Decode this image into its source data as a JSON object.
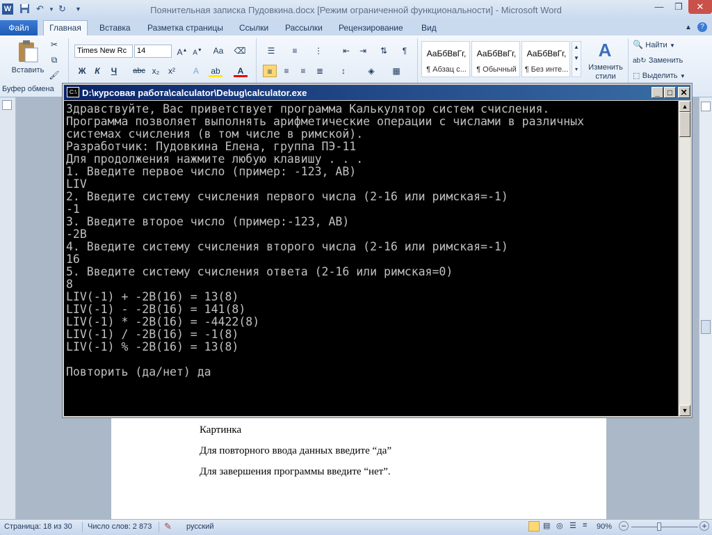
{
  "window": {
    "title": "Поянительная записка Пудовкина.docx [Режим ограниченной функциональности]  -  Microsoft Word"
  },
  "quick_access": {
    "word_icon": "W",
    "save_icon": "save-icon",
    "undo_icon": "undo-icon",
    "redo_icon": "redo-icon"
  },
  "tabs": [
    {
      "label": "Файл"
    },
    {
      "label": "Главная"
    },
    {
      "label": "Вставка"
    },
    {
      "label": "Разметка страницы"
    },
    {
      "label": "Ссылки"
    },
    {
      "label": "Рассылки"
    },
    {
      "label": "Рецензирование"
    },
    {
      "label": "Вид"
    }
  ],
  "ribbon": {
    "paste_label": "Вставить",
    "clipboard_group": "Буфер обмена",
    "font_name": "Times New Rc",
    "font_size": "14",
    "bold": "Ж",
    "italic": "К",
    "underline": "Ч",
    "strike": "abc",
    "subscript": "x₂",
    "superscript": "x²",
    "styles": [
      {
        "sample": "АаБбВвГг,",
        "name": "¶ Абзац с..."
      },
      {
        "sample": "АаБбВвГг,",
        "name": "¶ Обычный"
      },
      {
        "sample": "АаБбВвГг,",
        "name": "¶ Без инте..."
      }
    ],
    "change_styles": "Изменить стили",
    "find": "Найти",
    "replace": "Заменить",
    "select": "Выделить"
  },
  "console": {
    "title": "D:\\курсовая работа\\calculator\\Debug\\calculator.exe",
    "icon_text": "C:\\",
    "lines": [
      "Здравствуйте, Вас приветствует программа Калькулятор систем счисления.",
      "Программа позволяет выполнять арифметические операции с числами в различных",
      "системах счисления (в том числе в римской).",
      "Разработчик: Пудовкина Елена, группа ПЭ-11",
      "Для продолжения нажмите любую клавишу . . .",
      "1. Введите первое число (пример: -123, AB)",
      "LIV",
      "2. Введите систему счисления первого числа (2-16 или римская=-1)",
      "-1",
      "3. Введите второе число (пример:-123, AB)",
      "-2B",
      "4. Введите систему счисления второго числа (2-16 или римская=-1)",
      "16",
      "5. Введите систему счисления ответа (2-16 или римская=0)",
      "8",
      "LIV(-1) + -2B(16) = 13(8)",
      "LIV(-1) - -2B(16) = 141(8)",
      "LIV(-1) * -2B(16) = -4422(8)",
      "LIV(-1) / -2B(16) = -1(8)",
      "LIV(-1) % -2B(16) = 13(8)",
      "",
      "Повторить (да/нет) да"
    ]
  },
  "document": {
    "lines": [
      "Картинка",
      "Для повторного ввода данных введите “да”",
      "Для завершения программы введите “нет”."
    ]
  },
  "status": {
    "page": "Страница: 18 из 30",
    "words": "Число слов: 2 873",
    "language": "русский",
    "zoom": "90%"
  }
}
